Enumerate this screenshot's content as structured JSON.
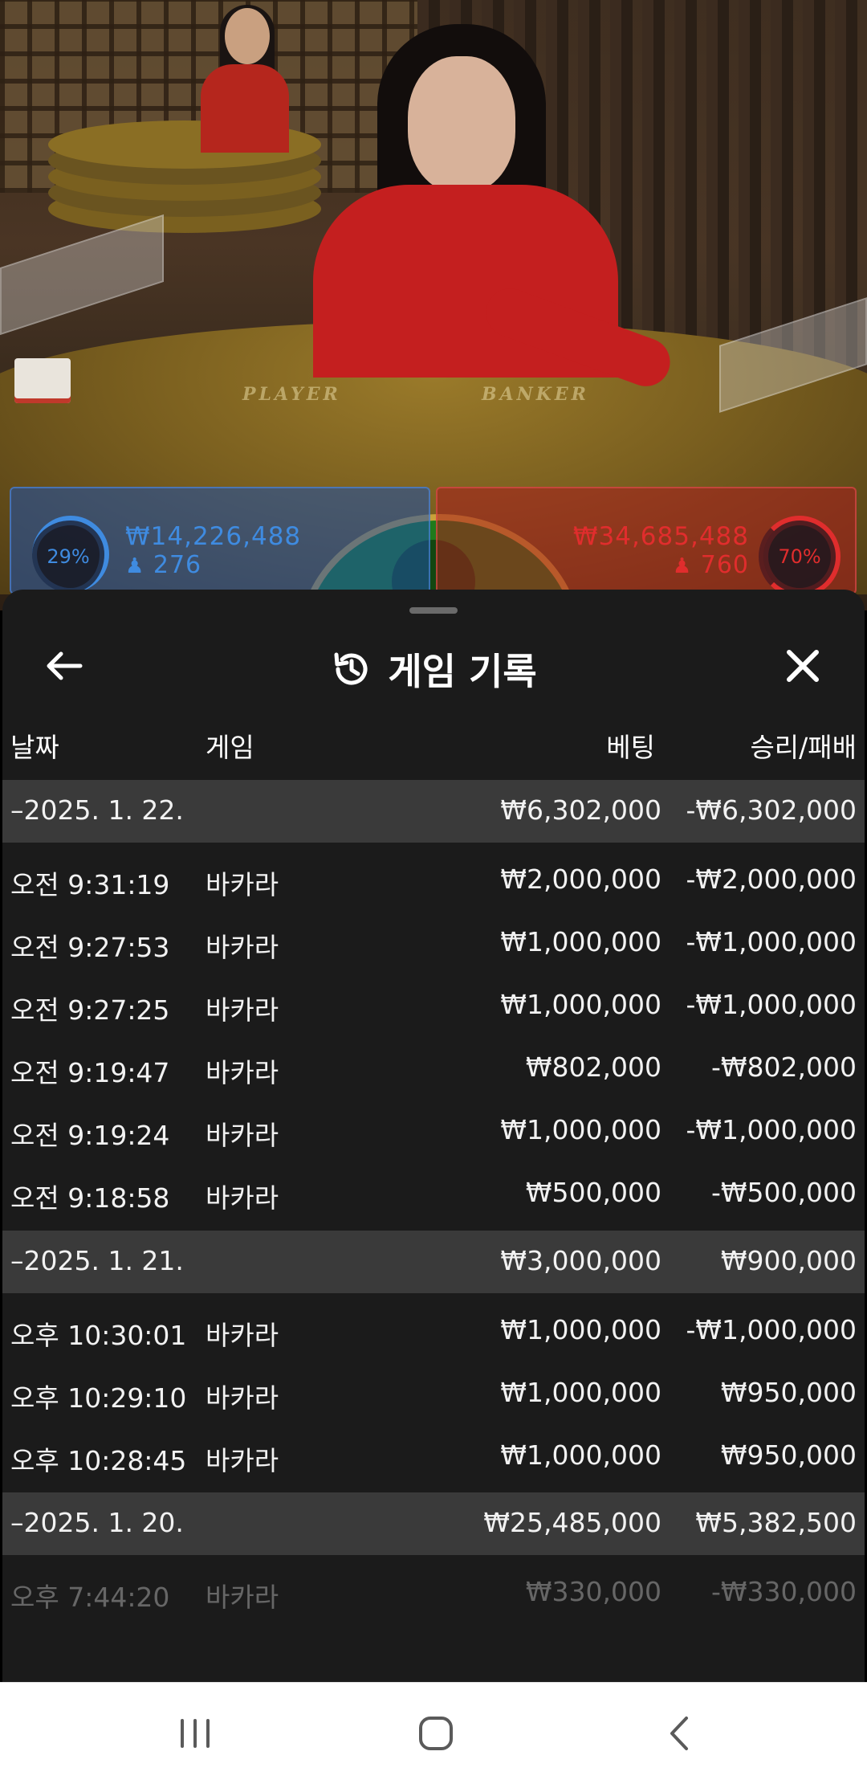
{
  "video": {
    "felt_labels": [
      "PLAYER",
      "BANKER"
    ]
  },
  "bets": {
    "player": {
      "percent": "29%",
      "amount": "₩14,226,488",
      "count": "276",
      "color": "#3f8be0"
    },
    "tie": {
      "percent": "1%",
      "color": "#44d144"
    },
    "banker": {
      "percent": "70%",
      "amount": "₩34,685,488",
      "count": "760",
      "color": "#e02d2d"
    }
  },
  "sheet": {
    "title": "게임 기록",
    "columns": {
      "date": "날짜",
      "game": "게임",
      "bet": "베팅",
      "result": "승리/패배"
    }
  },
  "history": [
    {
      "date": "–2025. 1. 22.",
      "bet_total": "₩6,302,000",
      "result_total": "-₩6,302,000",
      "items": [
        {
          "time": "오전 9:31:19",
          "game": "바카라",
          "bet": "₩2,000,000",
          "result": "-₩2,000,000"
        },
        {
          "time": "오전 9:27:53",
          "game": "바카라",
          "bet": "₩1,000,000",
          "result": "-₩1,000,000"
        },
        {
          "time": "오전 9:27:25",
          "game": "바카라",
          "bet": "₩1,000,000",
          "result": "-₩1,000,000"
        },
        {
          "time": "오전 9:19:47",
          "game": "바카라",
          "bet": "₩802,000",
          "result": "-₩802,000"
        },
        {
          "time": "오전 9:19:24",
          "game": "바카라",
          "bet": "₩1,000,000",
          "result": "-₩1,000,000"
        },
        {
          "time": "오전 9:18:58",
          "game": "바카라",
          "bet": "₩500,000",
          "result": "-₩500,000"
        }
      ]
    },
    {
      "date": "–2025. 1. 21.",
      "bet_total": "₩3,000,000",
      "result_total": "₩900,000",
      "items": [
        {
          "time": "오후 10:30:01",
          "game": "바카라",
          "bet": "₩1,000,000",
          "result": "-₩1,000,000"
        },
        {
          "time": "오후 10:29:10",
          "game": "바카라",
          "bet": "₩1,000,000",
          "result": "₩950,000"
        },
        {
          "time": "오후 10:28:45",
          "game": "바카라",
          "bet": "₩1,000,000",
          "result": "₩950,000"
        }
      ]
    },
    {
      "date": "–2025. 1. 20.",
      "bet_total": "₩25,485,000",
      "result_total": "₩5,382,500",
      "items": [
        {
          "time": "오후 7:44:20",
          "game": "바카라",
          "bet": "₩330,000",
          "result": "-₩330,000"
        }
      ]
    }
  ],
  "navbar": {
    "icons": [
      "recent-apps-icon",
      "home-icon",
      "back-icon"
    ]
  }
}
